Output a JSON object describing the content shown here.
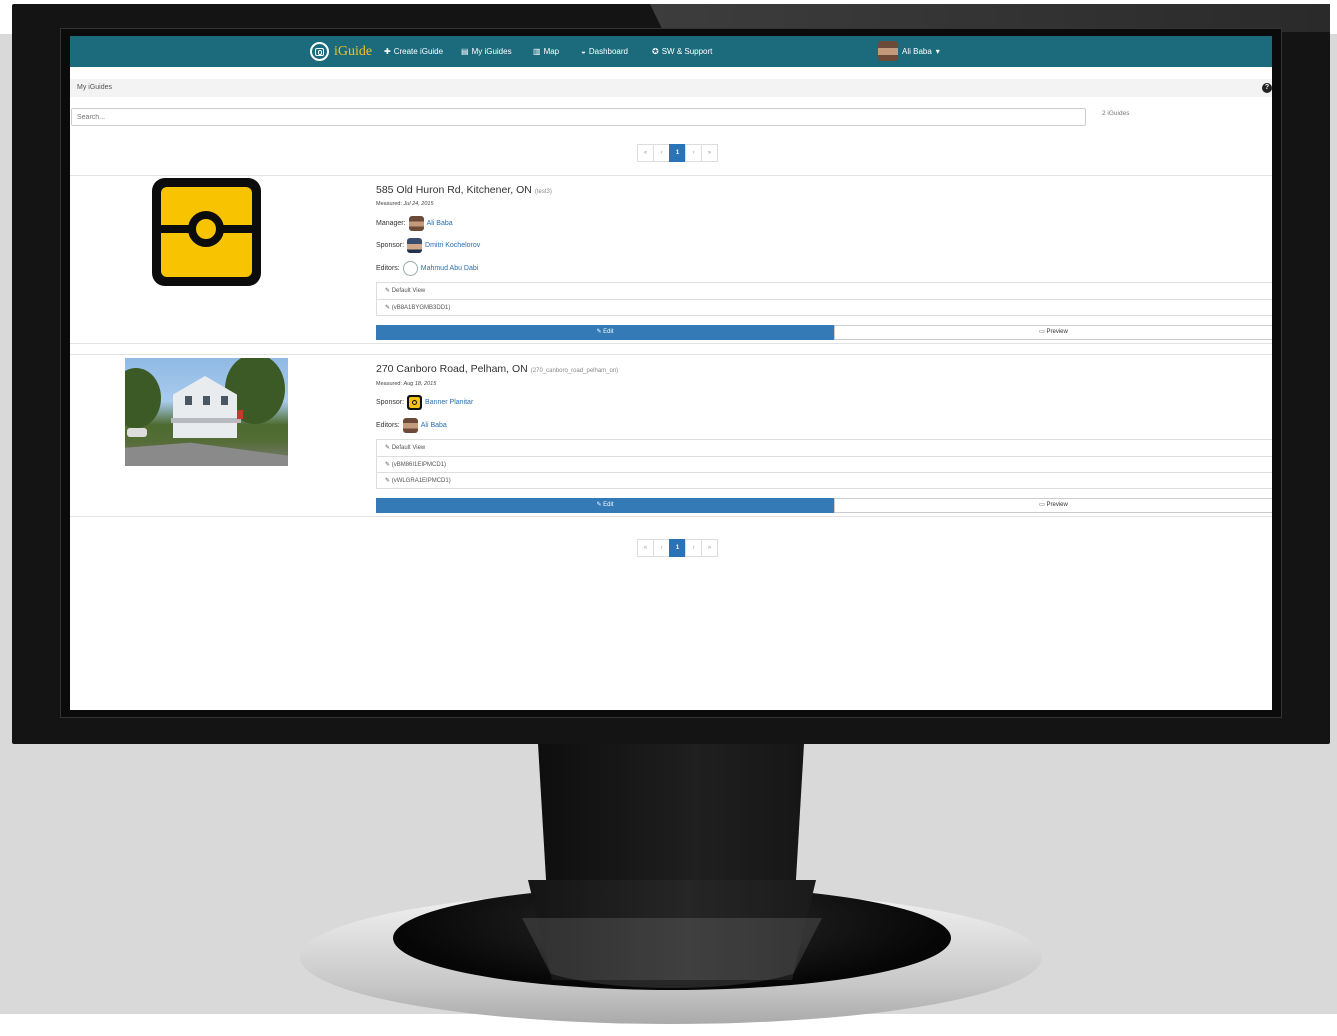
{
  "navbar": {
    "brand": "iGuide",
    "items": [
      {
        "icon": "plus-icon",
        "glyph": "✚",
        "label": "Create iGuide"
      },
      {
        "icon": "list-icon",
        "glyph": "▤",
        "label": "My iGuides"
      },
      {
        "icon": "map-icon",
        "glyph": "▥",
        "label": "Map"
      },
      {
        "icon": "dashboard-icon",
        "glyph": "◒",
        "label": "Dashboard"
      },
      {
        "icon": "support-icon",
        "glyph": "✪",
        "label": "SW & Support"
      }
    ],
    "user": "Ali Baba",
    "user_caret": "▾"
  },
  "breadcrumb": {
    "title": "My iGuides",
    "help_glyph": "?"
  },
  "search": {
    "placeholder": "Search...",
    "count": "2 iGuides"
  },
  "pagination": {
    "first": "«",
    "prev": "‹",
    "current": "1",
    "next": "›",
    "last": "»"
  },
  "items": [
    {
      "title": "585 Old Huron Rd, Kitchener, ON",
      "slug": "(test3)",
      "measured_label": "Measured:",
      "measured_date": "Jul 24, 2015",
      "manager_label": "Manager:",
      "manager": "Ali Baba",
      "sponsor_label": "Sponsor:",
      "sponsor": "Dmitri Kochelorov",
      "editors_label": "Editors:",
      "editor": "Mahmud Abu Dabi",
      "views": [
        "✎ Default View",
        "✎ (vB8A1BYGMB3DD1)"
      ],
      "edit_label": "✎ Edit",
      "preview_label": "▭ Preview"
    },
    {
      "title": "270 Canboro Road, Pelham, ON",
      "slug": "(270_canboro_road_pelham_on)",
      "measured_label": "Measured:",
      "measured_date": "Aug 18, 2015",
      "sponsor_label": "Sponsor:",
      "sponsor": "Banner Planitar",
      "editors_label": "Editors:",
      "editor": "Ali Baba",
      "views": [
        "✎ Default View",
        "✎ (vBM86I1EIPMCD1)",
        "✎ (vWLGRA1EIPMCD1)"
      ],
      "edit_label": "✎ Edit",
      "preview_label": "▭ Preview"
    }
  ],
  "colors": {
    "navbar": "#1c6b7d",
    "brand": "#f5c21a",
    "primary": "#337ab7",
    "logo_yellow": "#f8c300"
  }
}
